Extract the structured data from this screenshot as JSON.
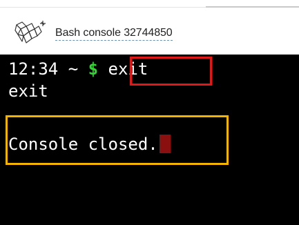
{
  "header": {
    "title": "Bash console 32744850",
    "logo_icon": "pythonanywhere-logo-icon"
  },
  "terminal": {
    "prompt_time": "12:34",
    "prompt_tilde": "~",
    "prompt_dollar": "$",
    "command": "exit",
    "output_line": "exit",
    "status_line": "Console closed.",
    "prompt_dollar_color": "#31d431",
    "cursor_color": "#8a1010",
    "background_color": "#000000"
  },
  "annotations": {
    "highlight_red_color": "#e01818",
    "highlight_orange_color": "#f2b400"
  }
}
